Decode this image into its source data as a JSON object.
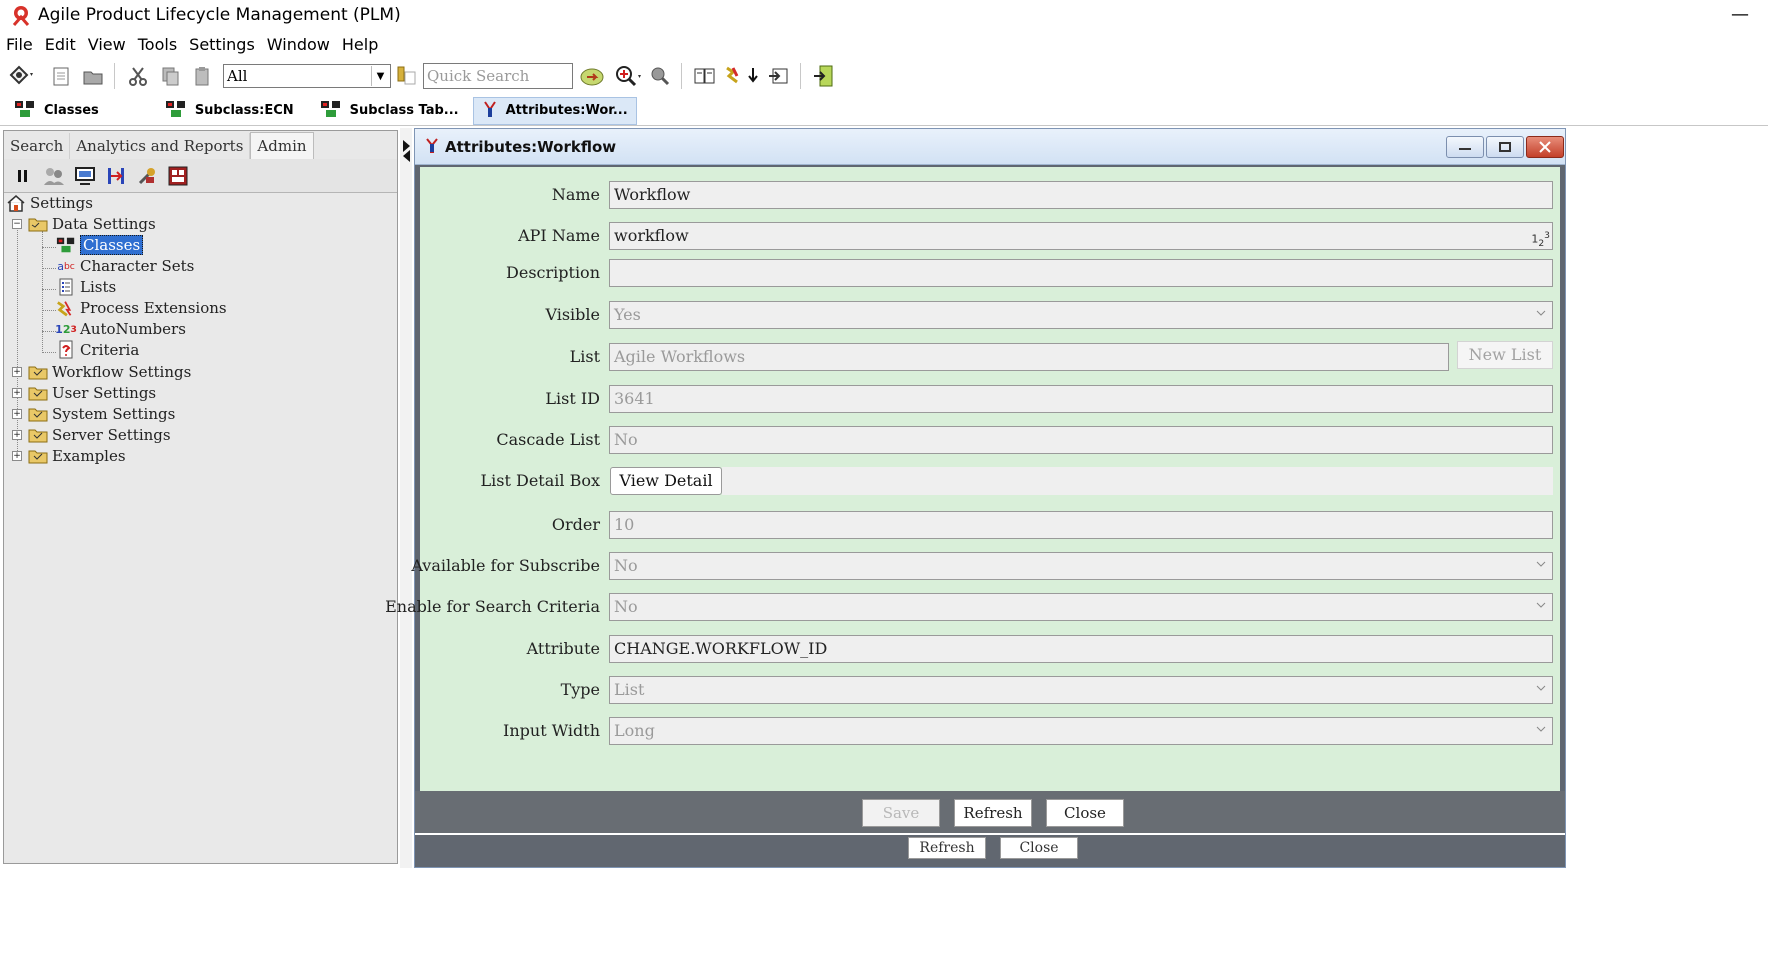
{
  "window": {
    "title": "Agile Product Lifecycle Management (PLM)",
    "minimize": "—"
  },
  "menu": [
    "File",
    "Edit",
    "View",
    "Tools",
    "Settings",
    "Window",
    "Help"
  ],
  "toolbar": {
    "scope_value": "All",
    "quick_search_placeholder": "Quick Search"
  },
  "doc_tabs": [
    {
      "label": "Classes",
      "active": false
    },
    {
      "label": "Subclass:ECN",
      "active": false
    },
    {
      "label": "Subclass Tab...",
      "active": false
    },
    {
      "label": "Attributes:Wor...",
      "active": true
    }
  ],
  "left_panel": {
    "tabs": [
      "Search",
      "Analytics and Reports",
      "Admin"
    ],
    "active_tab": "Admin",
    "tree": {
      "root": "Settings",
      "data_settings": "Data Settings",
      "children": [
        "Classes",
        "Character Sets",
        "Lists",
        "Process Extensions",
        "AutoNumbers",
        "Criteria"
      ],
      "selected": "Classes",
      "siblings": [
        "Workflow Settings",
        "User Settings",
        "System Settings",
        "Server Settings",
        "Examples"
      ]
    }
  },
  "inner_window": {
    "title": "Attributes:Workflow",
    "fields": {
      "name": {
        "label": "Name",
        "value": "Workflow"
      },
      "api_name": {
        "label": "API Name",
        "value": "workflow"
      },
      "description": {
        "label": "Description",
        "value": ""
      },
      "visible": {
        "label": "Visible",
        "value": "Yes"
      },
      "list": {
        "label": "List",
        "value": "Agile Workflows",
        "button": "New List"
      },
      "list_id": {
        "label": "List ID",
        "value": "3641"
      },
      "cascade_list": {
        "label": "Cascade List",
        "value": "No"
      },
      "list_detail_box": {
        "label": "List Detail Box",
        "button": "View Detail"
      },
      "order": {
        "label": "Order",
        "value": "10"
      },
      "available_for_subscribe": {
        "label": "Available for Subscribe",
        "value": "No"
      },
      "enable_for_search_criteria": {
        "label": "Enable for Search Criteria",
        "value": "No"
      },
      "attribute": {
        "label": "Attribute",
        "value": "CHANGE.WORKFLOW_ID"
      },
      "type": {
        "label": "Type",
        "value": "List"
      },
      "input_width": {
        "label": "Input Width",
        "value": "Long"
      }
    },
    "buttons": {
      "save": "Save",
      "refresh": "Refresh",
      "close": "Close"
    },
    "outer_buttons": {
      "refresh": "Refresh",
      "close": "Close"
    }
  },
  "colors": {
    "form_background": "#d9efd9",
    "selection": "#2f6fd1",
    "button_bar": "#686d73"
  }
}
